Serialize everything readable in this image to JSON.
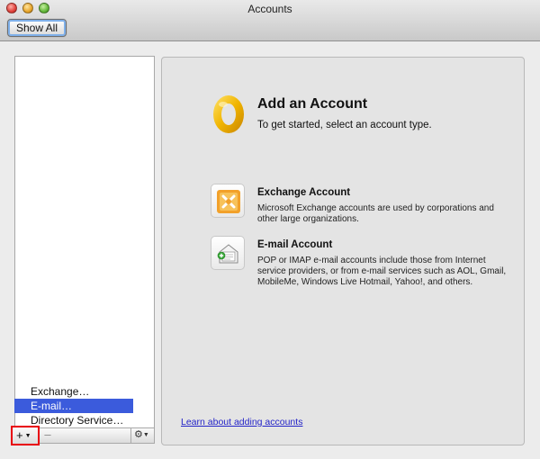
{
  "window": {
    "title": "Accounts",
    "toolbar": {
      "show_all_label": "Show All"
    }
  },
  "account_list": {
    "add_button_label": "+",
    "remove_button_label": "–",
    "gear_icon": "gear-icon",
    "menu": [
      {
        "label": "Exchange…",
        "selected": false
      },
      {
        "label": "E-mail…",
        "selected": true
      },
      {
        "label": "Directory Service…",
        "selected": false
      }
    ]
  },
  "main": {
    "title": "Add an Account",
    "subtitle": "To get started, select an account type.",
    "account_types": [
      {
        "title": "Exchange Account",
        "description": "Microsoft Exchange accounts are used by corporations and other large organizations.",
        "icon": "exchange-icon"
      },
      {
        "title": "E-mail Account",
        "description": "POP or IMAP e-mail accounts include those from Internet service providers, or from e-mail services such as AOL, Gmail, MobileMe, Windows Live Hotmail, Yahoo!, and others.",
        "icon": "email-icon"
      }
    ],
    "learn_link": "Learn about adding accounts"
  },
  "colors": {
    "selection": "#3b5bdc",
    "link": "#2323c8",
    "highlight_box": "#e8000c",
    "outlook_gold": "#f0b400"
  }
}
